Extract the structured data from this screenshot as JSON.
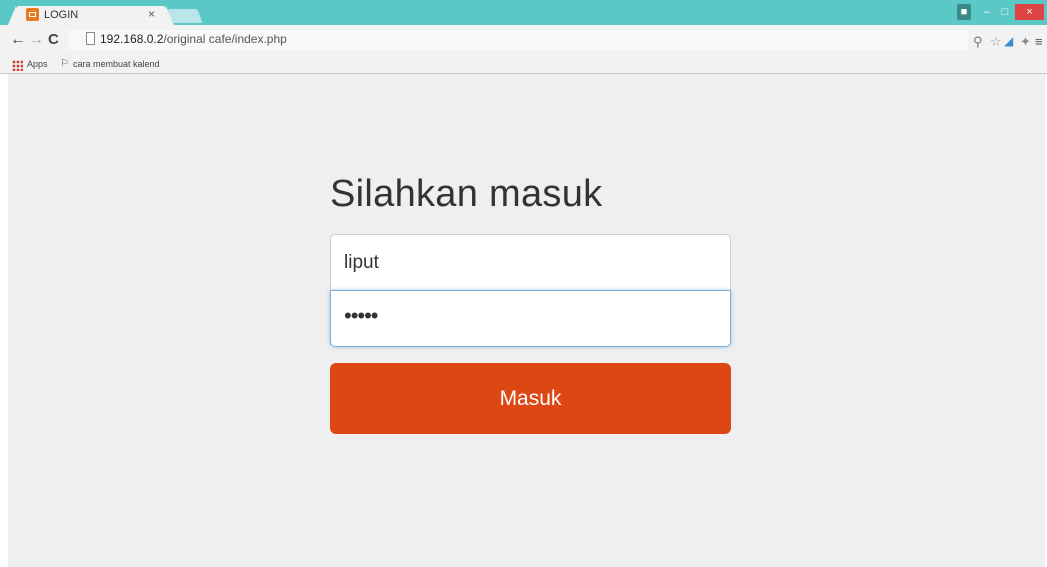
{
  "browser": {
    "tab": {
      "title": "LOGIN",
      "close": "×"
    },
    "window_buttons": {
      "minimize": "–",
      "maximize": "□",
      "close": "×"
    },
    "toolbar": {
      "back": "←",
      "forward": "→",
      "reload": "C",
      "url_host": "192.168.0.2",
      "url_path": "/original cafe/index.php"
    },
    "bookmarks": {
      "apps_label": "Apps",
      "items": [
        {
          "label": "cara membuat kalend"
        }
      ]
    }
  },
  "page": {
    "heading": "Silahkan masuk",
    "username_value": "liput",
    "password_value": "•••••",
    "submit_label": "Masuk"
  },
  "colors": {
    "titlebar": "#5bc8c8",
    "page_background": "#efefef",
    "submit_button": "#dc4714",
    "focus_border": "#7aaedb"
  }
}
